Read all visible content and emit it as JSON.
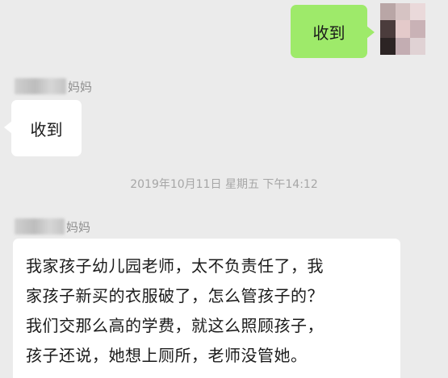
{
  "self_message": {
    "text": "收到",
    "bubble_color": "#9eea6a"
  },
  "messages": [
    {
      "sender_suffix": "妈妈",
      "text": "收到"
    },
    {
      "sender_suffix": "妈妈",
      "lines": [
        "我家孩子幼儿园老师，太不负责任了，我",
        "家孩子新买的衣服破了，怎么管孩子的？",
        "我们交那么高的学费，就这么照顾孩子，",
        "孩子还说，她想上厕所，老师没管她。"
      ]
    }
  ],
  "timestamp": "2019年10月11日 星期五 下午14:12",
  "colors": {
    "background": "#ebebeb",
    "received_bubble": "#ffffff",
    "sender_text": "#8f8f8f",
    "timestamp_text": "#a6a6a6"
  },
  "avatar_self": {
    "icon": "pixelated-avatar-icon"
  }
}
